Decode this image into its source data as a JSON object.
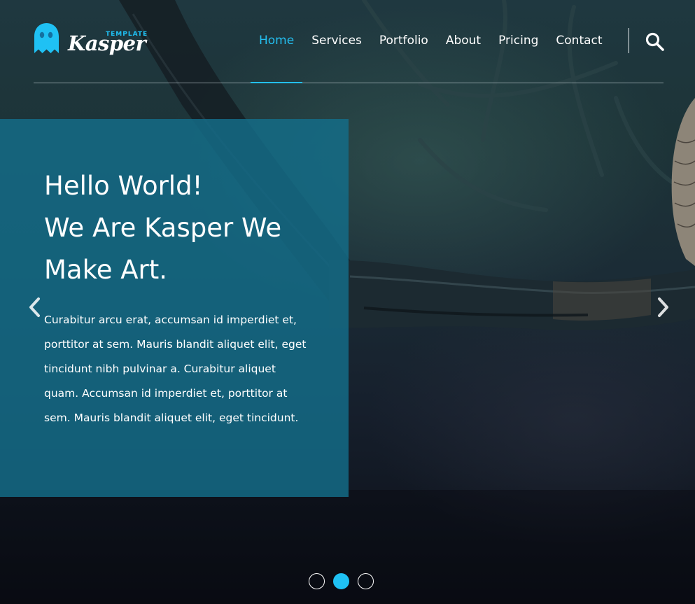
{
  "brand": {
    "name": "Kasper",
    "tagline": "TEMPLATE",
    "accent_color": "#1fc1f4"
  },
  "nav": {
    "items": [
      {
        "label": "Home",
        "active": true
      },
      {
        "label": "Services",
        "active": false
      },
      {
        "label": "Portfolio",
        "active": false
      },
      {
        "label": "About",
        "active": false
      },
      {
        "label": "Pricing",
        "active": false
      },
      {
        "label": "Contact",
        "active": false
      }
    ],
    "search_icon": "search-icon"
  },
  "hero": {
    "headline": [
      "Hello World!",
      "We Are Kasper We",
      "Make Art."
    ],
    "paragraph": "Curabitur arcu erat, accumsan id imperdiet et, porttitor at sem. Mauris blandit aliquet elit, eget tincidunt nibh pulvinar a. Curabitur aliquet quam. Accumsan id imperdiet et, porttitor at sem. Mauris blandit aliquet elit, eget tincidunt.",
    "panel_color": "#146e8a"
  },
  "slider": {
    "prev_icon": "chevron-left-icon",
    "next_icon": "chevron-right-icon",
    "dot_count": 3,
    "active_dot": 2
  }
}
